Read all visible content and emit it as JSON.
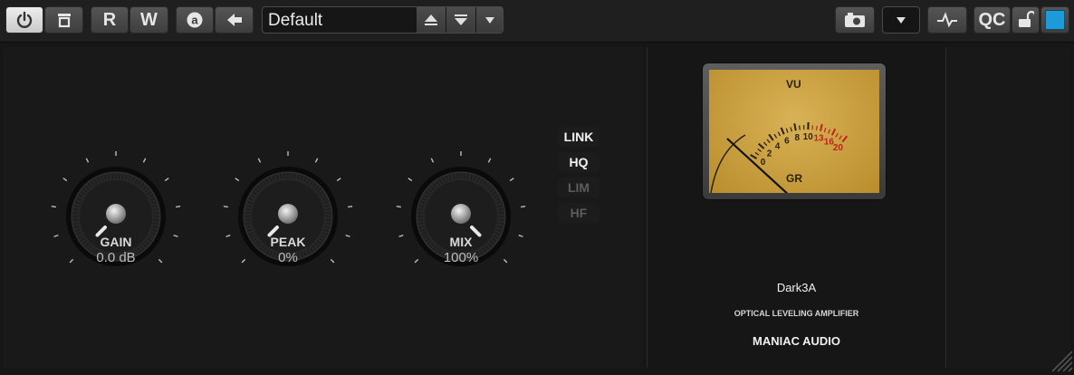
{
  "toolbar": {
    "read_label": "R",
    "write_label": "W",
    "preset_name": "Default",
    "qc_label": "QC"
  },
  "icons": {
    "power": "power-icon",
    "bypass": "bypass-icon",
    "auto": "auto-icon",
    "back": "back-arrow-icon",
    "preset_up": "arrow-up-icon",
    "preset_down": "arrow-down-icon",
    "preset_menu": "dropdown-icon",
    "camera": "camera-icon",
    "dropdown": "dropdown-icon",
    "activity": "activity-icon",
    "lock": "lock-icon"
  },
  "knobs": [
    {
      "label": "GAIN",
      "value": "0.0 dB",
      "level": 0.0
    },
    {
      "label": "PEAK",
      "value": "0%",
      "level": 0.0
    },
    {
      "label": "MIX",
      "value": "100%",
      "level": 1.0
    }
  ],
  "options": [
    {
      "label": "LINK",
      "active": true
    },
    {
      "label": "HQ",
      "active": true
    },
    {
      "label": "LIM",
      "active": false
    },
    {
      "label": "HF",
      "active": false
    }
  ],
  "vu_meter": {
    "top_label": "VU",
    "bottom_label": "GR",
    "scale_black": [
      "0",
      "2",
      "4",
      "6",
      "8",
      "10"
    ],
    "scale_red": [
      "13",
      "16",
      "20"
    ]
  },
  "brand": {
    "product": "Dark3A",
    "description": "OPTICAL LEVELING AMPLIFIER",
    "company": "MANIAC AUDIO"
  },
  "colors": {
    "accent": "#1e9ad6",
    "meter_face": "#c9a03e",
    "meter_red": "#c0201c"
  }
}
